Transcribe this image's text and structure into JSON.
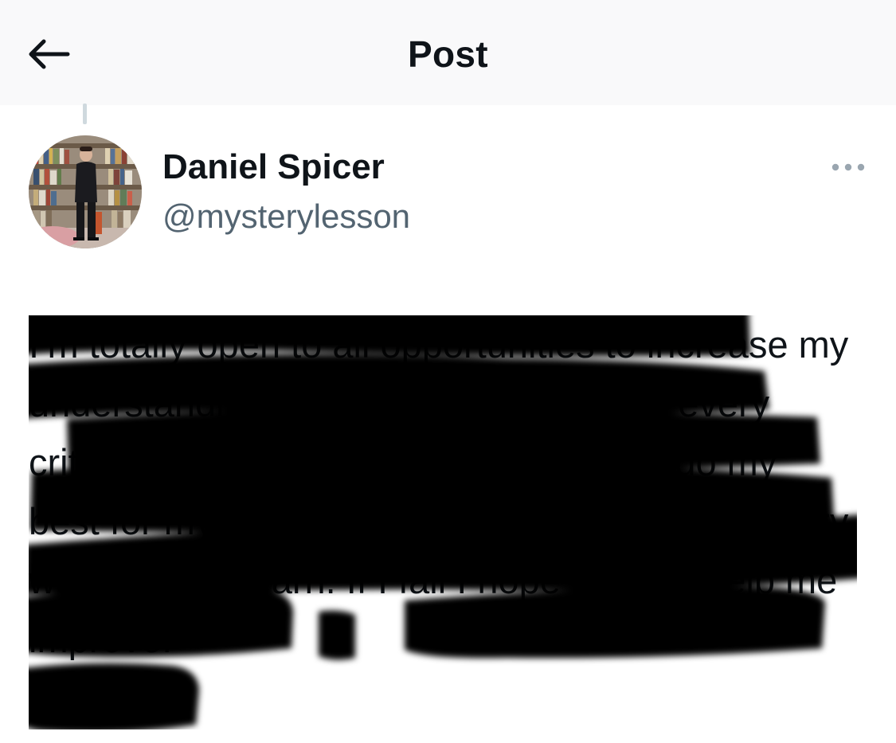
{
  "header": {
    "title": "Post",
    "back_icon": "arrow-left-icon"
  },
  "post": {
    "author": {
      "name": "Daniel Spicer",
      "handle": "@mysterylesson"
    },
    "more_icon": "more-horizontal-icon",
    "text": "I’m totally open to all opportunities to increase my understanding, and very much open to every criticism that comes my way. I strive to do my best for myself and everyone I encounter in every way. I live to learn. If I fail I hope you will help me improve.",
    "redacted": true
  },
  "colors": {
    "header_bg": "#f9f9fa",
    "text": "#0f1419",
    "secondary_text": "#536471",
    "redaction": "#000000"
  }
}
